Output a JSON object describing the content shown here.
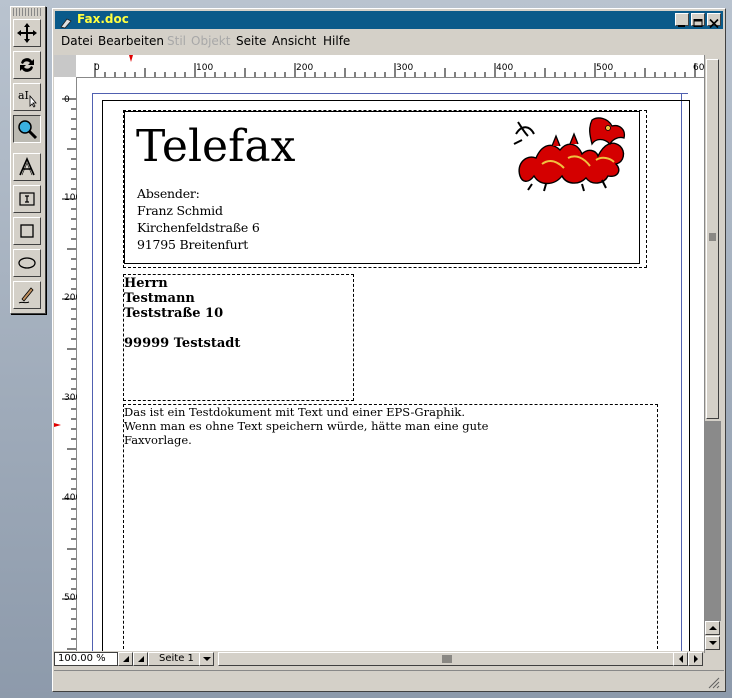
{
  "window": {
    "title": "Fax.doc"
  },
  "menu": {
    "items": [
      {
        "label": "Datei",
        "enabled": true
      },
      {
        "label": "Bearbeiten",
        "enabled": true
      },
      {
        "label": "Stil",
        "enabled": false
      },
      {
        "label": "Objekt",
        "enabled": false
      },
      {
        "label": "Seite",
        "enabled": true
      },
      {
        "label": "Ansicht",
        "enabled": true
      },
      {
        "label": "Hilfe",
        "enabled": true
      }
    ]
  },
  "tools": [
    {
      "name": "move-tool",
      "icon": "move-arrows-icon"
    },
    {
      "name": "rotate-tool",
      "icon": "rotate-icon"
    },
    {
      "name": "text-edit-tool",
      "icon": "text-cursor-icon"
    },
    {
      "name": "zoom-tool",
      "icon": "magnifier-icon",
      "active": true
    },
    {
      "name": "text-art-tool",
      "icon": "text-a-icon"
    },
    {
      "name": "text-frame-tool",
      "icon": "text-frame-icon"
    },
    {
      "name": "rectangle-tool",
      "icon": "rectangle-icon"
    },
    {
      "name": "ellipse-tool",
      "icon": "ellipse-icon"
    },
    {
      "name": "freehand-tool",
      "icon": "pen-icon"
    }
  ],
  "ruler": {
    "horizontal_labels": [
      "0",
      "100",
      "200",
      "300",
      "400",
      "500",
      "60"
    ],
    "vertical_labels": [
      "0",
      "100",
      "200",
      "300",
      "400",
      "500"
    ]
  },
  "document": {
    "heading": "Telefax",
    "sender": {
      "label": "Absender:",
      "name": "Franz Schmid",
      "street": "Kirchenfeldstraße 6",
      "city": "91795 Breitenfurt"
    },
    "recipient": {
      "line1": "Herrn",
      "line2": "Testmann",
      "line3": "Teststraße 10",
      "line4": "99999 Teststadt"
    },
    "body": [
      "Das ist ein Testdokument mit Text und einer EPS-Graphik.",
      "Wenn man es ohne Text speichern würde, hätte man eine gute",
      "Faxvorlage."
    ],
    "image": "dragon-graphic",
    "accent_color": "#cc0000"
  },
  "statusbar": {
    "zoom": "100.00 %",
    "page": "Seite 1"
  }
}
